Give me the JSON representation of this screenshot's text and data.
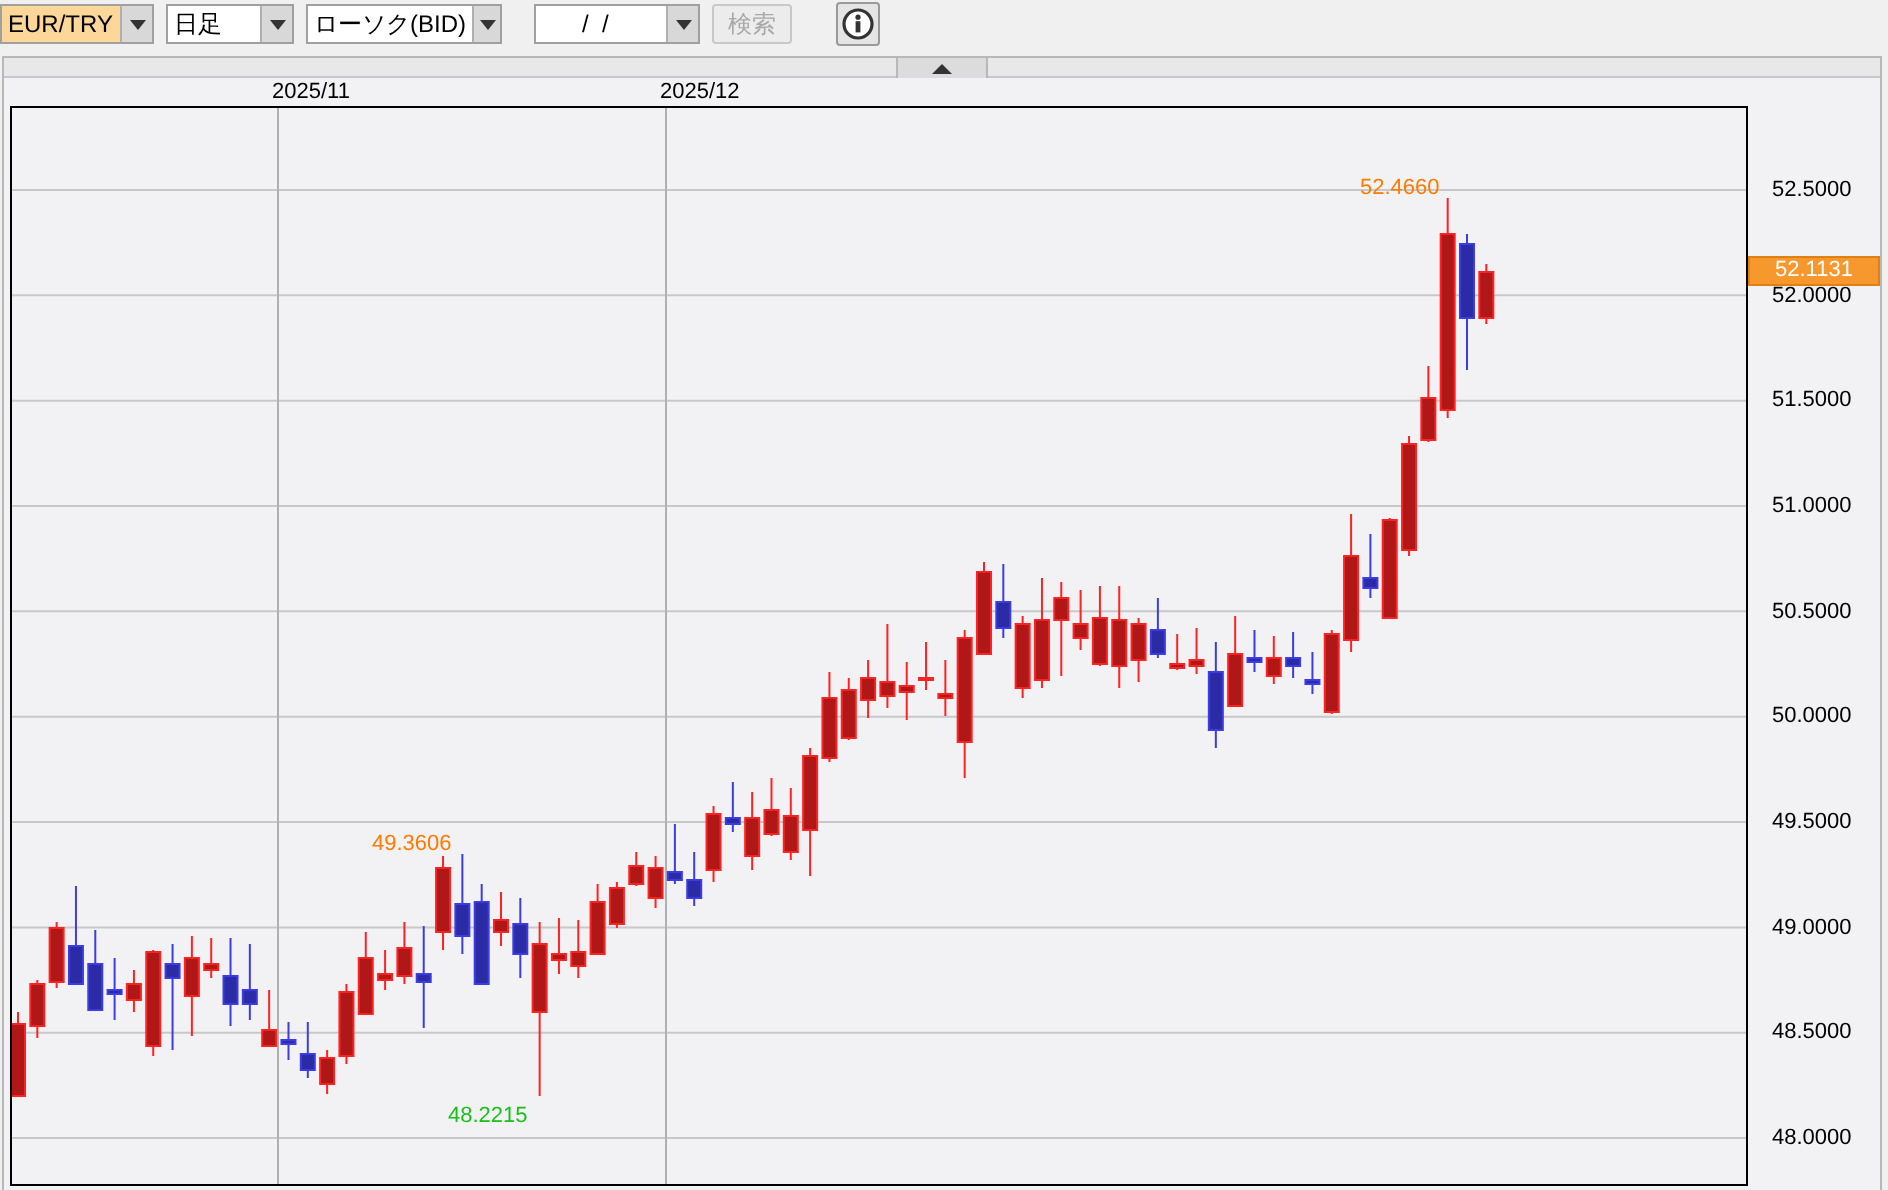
{
  "toolbar": {
    "symbol": {
      "value": "EUR/TRY"
    },
    "period": {
      "value": "日足"
    },
    "chart_type": {
      "value": "ローソク(BID)"
    },
    "date": {
      "value": "/  /"
    },
    "search_button": {
      "label": "検索",
      "disabled": true
    }
  },
  "chart": {
    "x_labels": [
      "2025/11",
      "2025/12"
    ],
    "y_labels": [
      "52.5000",
      "52.0000",
      "51.5000",
      "51.0000",
      "50.5000",
      "50.0000",
      "49.5000",
      "49.0000",
      "48.5000",
      "48.0000"
    ],
    "current_price": "52.1131",
    "annotations": [
      {
        "kind": "high",
        "text": "52.4660"
      },
      {
        "kind": "high",
        "text": "49.3606"
      },
      {
        "kind": "low",
        "text": "48.2215"
      }
    ]
  }
}
